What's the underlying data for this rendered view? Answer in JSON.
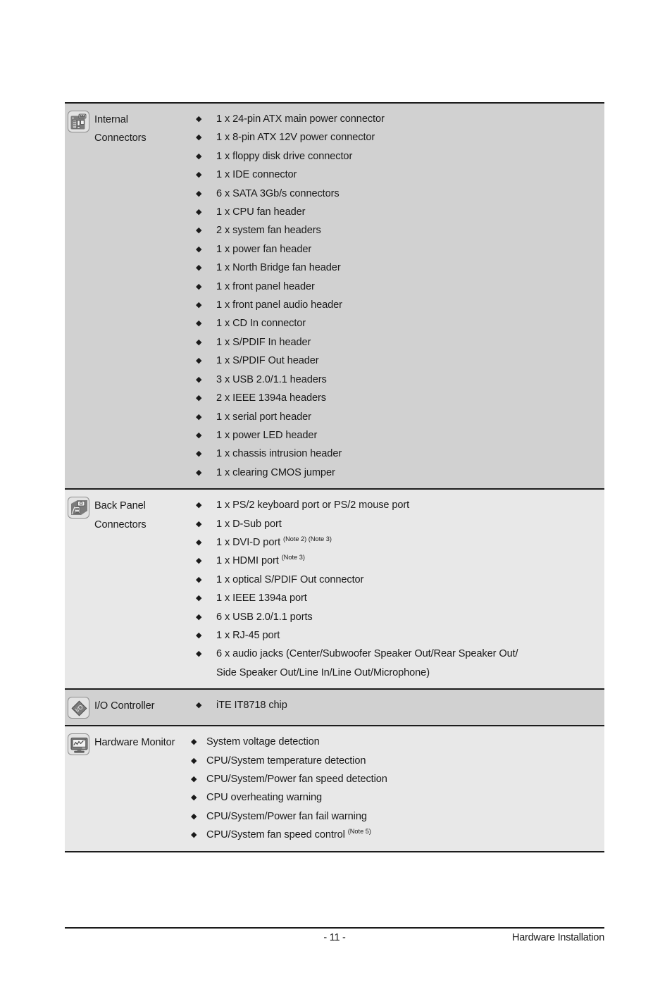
{
  "page": {
    "footer": {
      "page_number": "- 11 -",
      "chapter": "Hardware Installation"
    }
  },
  "bullet_glyph": "◆",
  "colors": {
    "row_shade_dark": "#d1d1d1",
    "row_shade_light": "#e8e8e8",
    "rule": "#1c1c1c",
    "text": "#1a1a1a",
    "icon_fill": "#e3e3e3",
    "icon_border": "#8e8e8e"
  },
  "table": {
    "rows": [
      {
        "icon": "motherboard-icon",
        "label": "Internal\nConnectors",
        "shade": "dark",
        "items": [
          {
            "text": "1 x 24-pin ATX main power connector"
          },
          {
            "text": "1 x 8-pin ATX 12V power connector"
          },
          {
            "text": "1 x floppy disk drive connector"
          },
          {
            "text": "1 x IDE connector"
          },
          {
            "text": "6 x SATA 3Gb/s connectors"
          },
          {
            "text": "1 x CPU fan header"
          },
          {
            "text": "2 x system fan headers"
          },
          {
            "text": "1 x power fan header"
          },
          {
            "text": "1 x North Bridge fan header"
          },
          {
            "text": "1 x front panel header"
          },
          {
            "text": "1 x front panel audio header"
          },
          {
            "text": "1 x CD In connector"
          },
          {
            "text": "1 x S/PDIF In header"
          },
          {
            "text": "1 x S/PDIF Out header"
          },
          {
            "text": "3 x USB 2.0/1.1 headers"
          },
          {
            "text": "2 x IEEE 1394a headers"
          },
          {
            "text": "1 x serial port header"
          },
          {
            "text": "1 x power LED header"
          },
          {
            "text": "1 x chassis intrusion header"
          },
          {
            "text": "1 x clearing CMOS jumper"
          }
        ]
      },
      {
        "icon": "back-panel-icon",
        "label": "Back Panel\nConnectors",
        "shade": "light",
        "items": [
          {
            "text": "1 x PS/2 keyboard port or PS/2 mouse port"
          },
          {
            "text": "1 x D-Sub port"
          },
          {
            "text": "1 x DVI-D port",
            "notes": "(Note 2) (Note 3)"
          },
          {
            "text": "1 x HDMI port",
            "notes": "(Note 3)"
          },
          {
            "text": "1 x optical S/PDIF Out connector"
          },
          {
            "text": "1 x IEEE 1394a port"
          },
          {
            "text": "6 x USB 2.0/1.1 ports"
          },
          {
            "text": "1 x RJ-45 port"
          },
          {
            "text": "6 x audio jacks (Center/Subwoofer Speaker Out/Rear Speaker Out/"
          },
          {
            "text": "Side Speaker Out/Line In/Line Out/Microphone)",
            "continuation": true
          }
        ]
      },
      {
        "icon": "io-chip-icon",
        "label": "I/O Controller",
        "shade": "dark",
        "items": [
          {
            "text": "iTE IT8718 chip"
          }
        ]
      },
      {
        "icon": "hardware-monitor-icon",
        "label": "Hardware Monitor",
        "shade": "light",
        "tight": true,
        "items": [
          {
            "text": "System voltage detection"
          },
          {
            "text": "CPU/System temperature detection"
          },
          {
            "text": "CPU/System/Power fan speed detection"
          },
          {
            "text": "CPU overheating warning"
          },
          {
            "text": "CPU/System/Power fan fail warning"
          },
          {
            "text": "CPU/System fan speed control",
            "notes": "(Note 5)"
          }
        ]
      }
    ]
  }
}
